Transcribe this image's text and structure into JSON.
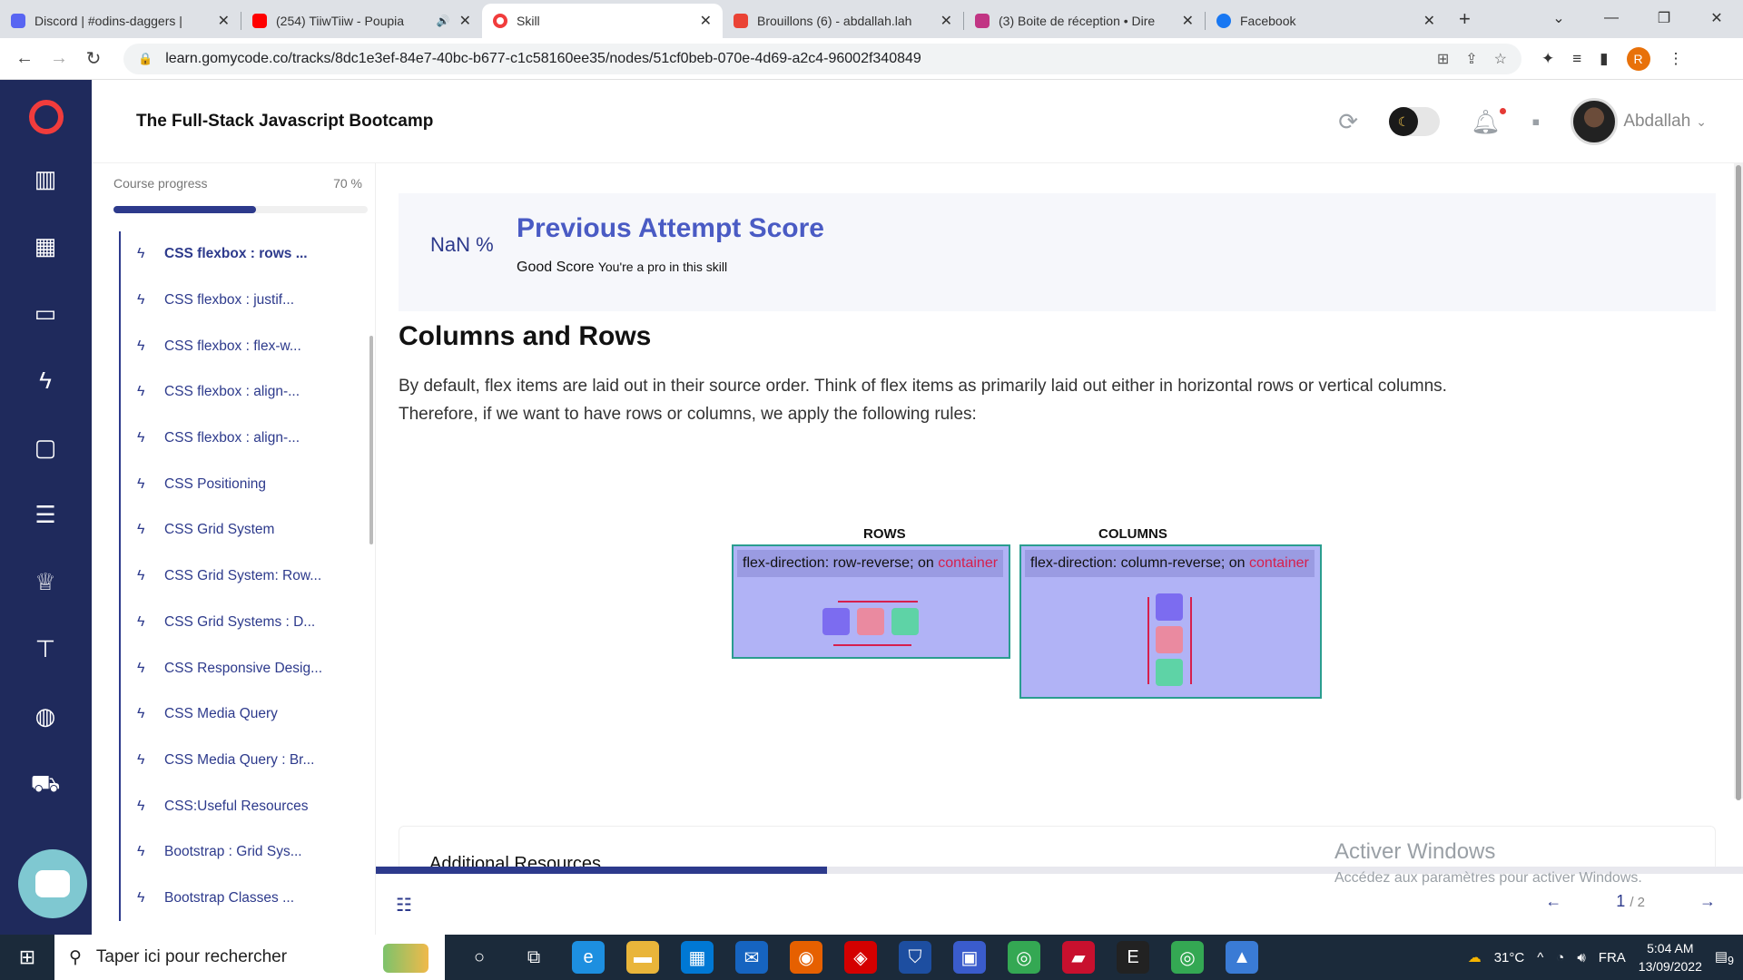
{
  "browser": {
    "tabs": [
      {
        "title": "Discord | #odins-daggers | ",
        "color": "#5865f2",
        "active": false
      },
      {
        "title": "(254) TiiwTiiw - Poupia",
        "color": "#ff0000",
        "active": false,
        "audio": "🔊"
      },
      {
        "title": "Skill",
        "color": "#f13c3c",
        "active": true
      },
      {
        "title": "Brouillons (6) - abdallah.lah",
        "color": "#ea4335",
        "active": false
      },
      {
        "title": "(3) Boite de réception • Dire",
        "color": "#c13584",
        "active": false
      },
      {
        "title": "Facebook",
        "color": "#1877f2",
        "active": false
      }
    ],
    "url": "learn.gomycode.co/tracks/8dc1e3ef-84e7-40bc-b677-c1c58160ee35/nodes/51cf0beb-070e-4d69-a2c4-96002f340849",
    "profile_initial": "R"
  },
  "header": {
    "course_title": "The Full-Stack Javascript Bootcamp",
    "user_name": "Abdallah"
  },
  "sidebar": {
    "progress_label": "Course progress",
    "progress_text": "70 %",
    "progress_value": 0.56,
    "lessons": [
      {
        "label": "CSS flexbox : rows ...",
        "active": true
      },
      {
        "label": "CSS flexbox : justif..."
      },
      {
        "label": "CSS flexbox : flex-w..."
      },
      {
        "label": "CSS flexbox : align-..."
      },
      {
        "label": "CSS flexbox : align-..."
      },
      {
        "label": "CSS Positioning"
      },
      {
        "label": "CSS Grid System"
      },
      {
        "label": "CSS Grid System: Row..."
      },
      {
        "label": "CSS Grid Systems : D..."
      },
      {
        "label": "CSS Responsive Desig..."
      },
      {
        "label": "CSS Media Query"
      },
      {
        "label": "CSS Media Query : Br..."
      },
      {
        "label": "CSS:Useful Resources"
      },
      {
        "label": "Bootstrap : Grid Sys..."
      },
      {
        "label": "Bootstrap Classes ..."
      }
    ]
  },
  "score": {
    "value": "NaN %",
    "title": "Previous Attempt Score",
    "label": "Good Score",
    "note": "You're a pro in this skill"
  },
  "content": {
    "heading": "Columns and Rows",
    "paragraph_1": "By default, flex items are laid out in their source order. Think of flex items as primarily laid out either in horizontal rows or vertical columns.",
    "paragraph_2": "Therefore, if we want to have rows or columns, we apply the following rules:",
    "diagram": {
      "rows_title": "ROWS",
      "columns_title": "COLUMNS",
      "rows_code_prop": "flex-direction:",
      "rows_code_val": "row-reverse;",
      "columns_code_prop": "flex-direction:",
      "columns_code_val": "column-reverse;",
      "on": "on",
      "container": "container"
    },
    "resources_title": "Additional Resources"
  },
  "footer": {
    "page": "1",
    "total": "/ 2",
    "progress_value": 0.33
  },
  "watermark": {
    "line1": "Activer Windows",
    "line2": "Accédez aux paramètres pour activer Windows."
  },
  "taskbar": {
    "search_placeholder": "Taper ici pour rechercher",
    "weather": "31°C",
    "lang": "FRA",
    "time": "5:04 AM",
    "date": "13/09/2022",
    "notifications": "9"
  }
}
